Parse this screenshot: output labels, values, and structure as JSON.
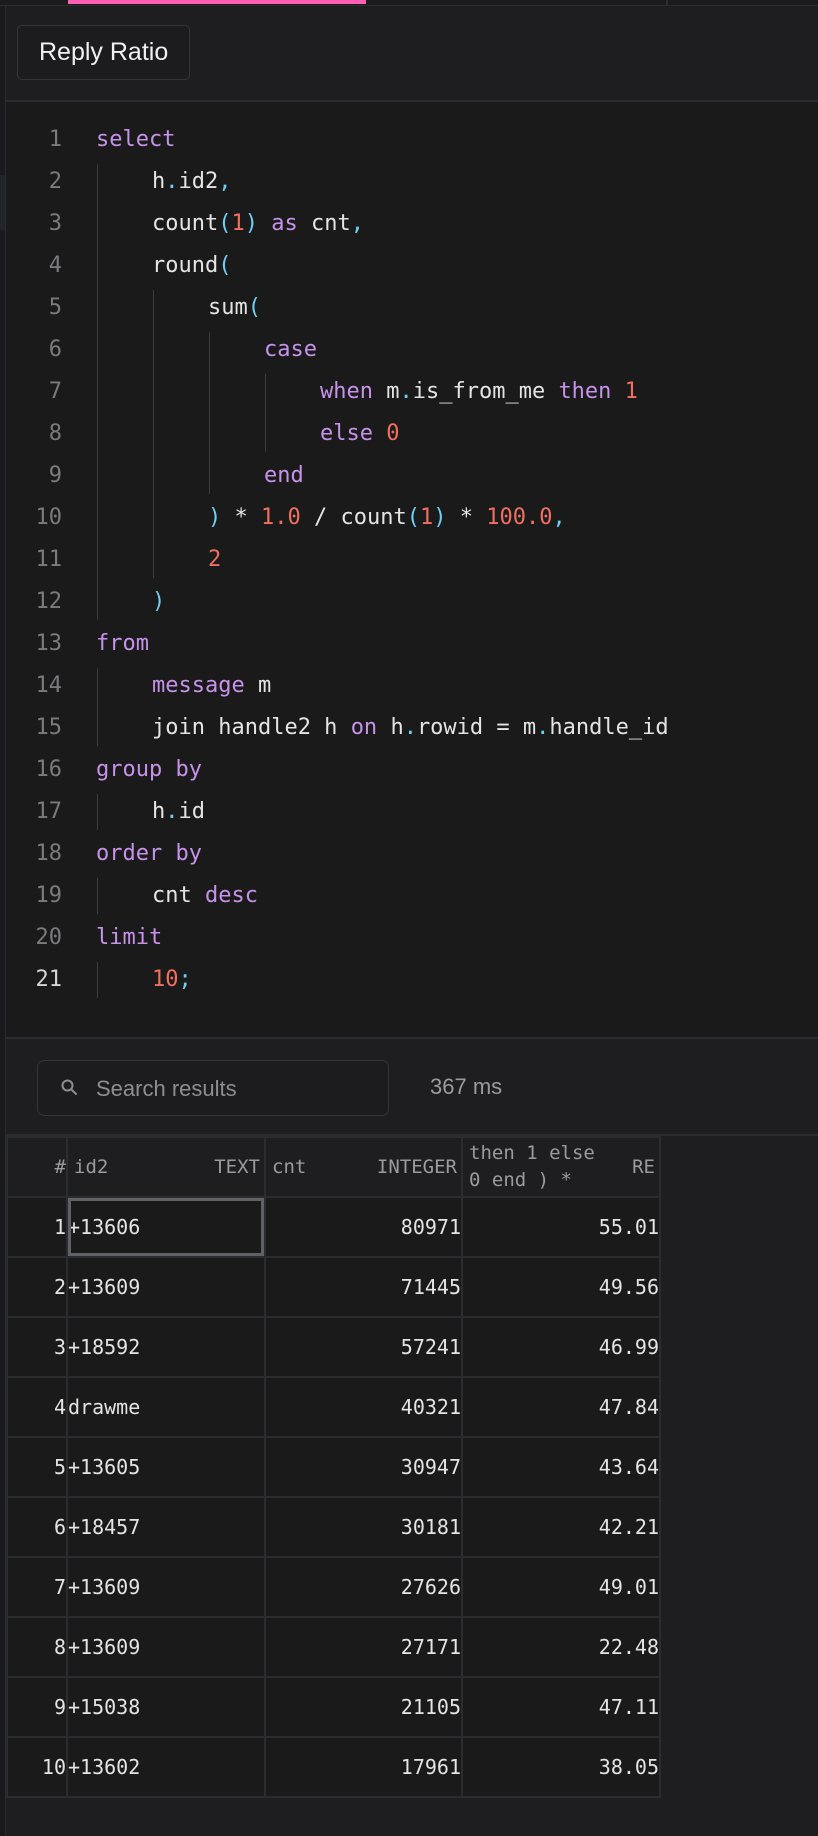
{
  "theme": {
    "accent": "#ff5fb3"
  },
  "header": {
    "query_name": "Reply Ratio"
  },
  "editor": {
    "active_line": 21,
    "lines": [
      {
        "n": "1",
        "indent": 0,
        "tokens": [
          {
            "t": "select",
            "c": "kw"
          }
        ]
      },
      {
        "n": "2",
        "indent": 1,
        "tokens": [
          {
            "t": "h",
            "c": "id"
          },
          {
            "t": ".",
            "c": "punc"
          },
          {
            "t": "id2",
            "c": "id"
          },
          {
            "t": ",",
            "c": "punc"
          }
        ]
      },
      {
        "n": "3",
        "indent": 1,
        "tokens": [
          {
            "t": "count",
            "c": "id"
          },
          {
            "t": "(",
            "c": "punc"
          },
          {
            "t": "1",
            "c": "num"
          },
          {
            "t": ")",
            "c": "punc"
          },
          {
            "t": " as ",
            "c": "kw"
          },
          {
            "t": "cnt",
            "c": "id"
          },
          {
            "t": ",",
            "c": "punc"
          }
        ]
      },
      {
        "n": "4",
        "indent": 1,
        "tokens": [
          {
            "t": "round",
            "c": "id"
          },
          {
            "t": "(",
            "c": "punc"
          }
        ]
      },
      {
        "n": "5",
        "indent": 2,
        "tokens": [
          {
            "t": "sum",
            "c": "id"
          },
          {
            "t": "(",
            "c": "punc"
          }
        ]
      },
      {
        "n": "6",
        "indent": 3,
        "tokens": [
          {
            "t": "case",
            "c": "kw"
          }
        ]
      },
      {
        "n": "7",
        "indent": 4,
        "tokens": [
          {
            "t": "when ",
            "c": "kw"
          },
          {
            "t": "m",
            "c": "id"
          },
          {
            "t": ".",
            "c": "punc"
          },
          {
            "t": "is_from_me ",
            "c": "id"
          },
          {
            "t": "then ",
            "c": "kw"
          },
          {
            "t": "1",
            "c": "num"
          }
        ]
      },
      {
        "n": "8",
        "indent": 4,
        "tokens": [
          {
            "t": "else ",
            "c": "kw"
          },
          {
            "t": "0",
            "c": "num"
          }
        ]
      },
      {
        "n": "9",
        "indent": 3,
        "tokens": [
          {
            "t": "end",
            "c": "kw"
          }
        ]
      },
      {
        "n": "10",
        "indent": 2,
        "tokens": [
          {
            "t": ")",
            "c": "punc"
          },
          {
            "t": " * ",
            "c": "id"
          },
          {
            "t": "1.0",
            "c": "num"
          },
          {
            "t": " / ",
            "c": "id"
          },
          {
            "t": "count",
            "c": "id"
          },
          {
            "t": "(",
            "c": "punc"
          },
          {
            "t": "1",
            "c": "num"
          },
          {
            "t": ")",
            "c": "punc"
          },
          {
            "t": " * ",
            "c": "id"
          },
          {
            "t": "100.0",
            "c": "num"
          },
          {
            "t": ",",
            "c": "punc"
          }
        ]
      },
      {
        "n": "11",
        "indent": 2,
        "tokens": [
          {
            "t": "2",
            "c": "num"
          }
        ]
      },
      {
        "n": "12",
        "indent": 1,
        "tokens": [
          {
            "t": ")",
            "c": "punc"
          }
        ]
      },
      {
        "n": "13",
        "indent": 0,
        "tokens": [
          {
            "t": "from",
            "c": "kw"
          }
        ]
      },
      {
        "n": "14",
        "indent": 1,
        "tokens": [
          {
            "t": "message ",
            "c": "kw"
          },
          {
            "t": "m",
            "c": "id"
          }
        ]
      },
      {
        "n": "15",
        "indent": 1,
        "tokens": [
          {
            "t": "join handle2 h ",
            "c": "id"
          },
          {
            "t": "on ",
            "c": "kw"
          },
          {
            "t": "h",
            "c": "id"
          },
          {
            "t": ".",
            "c": "punc"
          },
          {
            "t": "rowid = m",
            "c": "id"
          },
          {
            "t": ".",
            "c": "punc"
          },
          {
            "t": "handle_id",
            "c": "id"
          }
        ]
      },
      {
        "n": "16",
        "indent": 0,
        "tokens": [
          {
            "t": "group by",
            "c": "kw"
          }
        ]
      },
      {
        "n": "17",
        "indent": 1,
        "tokens": [
          {
            "t": "h",
            "c": "id"
          },
          {
            "t": ".",
            "c": "punc"
          },
          {
            "t": "id",
            "c": "id"
          }
        ]
      },
      {
        "n": "18",
        "indent": 0,
        "tokens": [
          {
            "t": "order by",
            "c": "kw"
          }
        ]
      },
      {
        "n": "19",
        "indent": 1,
        "tokens": [
          {
            "t": "cnt ",
            "c": "id"
          },
          {
            "t": "desc",
            "c": "kw"
          }
        ]
      },
      {
        "n": "20",
        "indent": 0,
        "tokens": [
          {
            "t": "limit",
            "c": "kw"
          }
        ]
      },
      {
        "n": "21",
        "indent": 1,
        "tokens": [
          {
            "t": "10",
            "c": "num"
          },
          {
            "t": ";",
            "c": "punc"
          }
        ]
      }
    ]
  },
  "results": {
    "search": {
      "placeholder": "Search results",
      "value": ""
    },
    "timing": "367 ms",
    "columns": [
      {
        "name": "#",
        "type": ""
      },
      {
        "name": "id2",
        "type": "TEXT"
      },
      {
        "name": "cnt",
        "type": "INTEGER"
      },
      {
        "name": "then 1 else\n0 end ) *",
        "type": "RE"
      }
    ],
    "selected_cell": {
      "row": 0,
      "col": 1
    },
    "rows": [
      [
        "1",
        "+13606",
        "80971",
        "55.01"
      ],
      [
        "2",
        "+13609",
        "71445",
        "49.56"
      ],
      [
        "3",
        "+18592",
        "57241",
        "46.99"
      ],
      [
        "4",
        "drawme",
        "40321",
        "47.84"
      ],
      [
        "5",
        "+13605",
        "30947",
        "43.64"
      ],
      [
        "6",
        "+18457",
        "30181",
        "42.21"
      ],
      [
        "7",
        "+13609",
        "27626",
        "49.01"
      ],
      [
        "8",
        "+13609",
        "27171",
        "22.48"
      ],
      [
        "9",
        "+15038",
        "21105",
        "47.11"
      ],
      [
        "10",
        "+13602",
        "17961",
        "38.05"
      ]
    ]
  }
}
